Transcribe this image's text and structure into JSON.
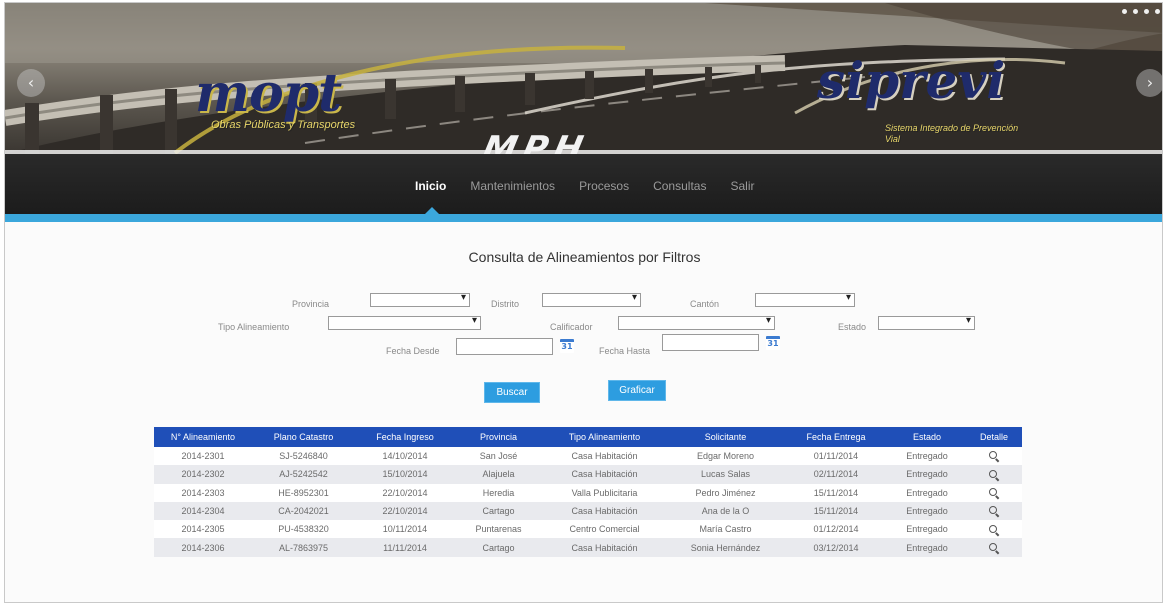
{
  "banner": {
    "logo_left": "mopt",
    "logo_left_sub": "Obras Públicas y Transportes",
    "logo_center": "MPH",
    "logo_right": "siprevi",
    "logo_right_sub": "Sistema Integrado de Prevención Vial",
    "prev_arrow": "‹",
    "next_arrow": "›"
  },
  "nav": {
    "items": [
      "Inicio",
      "Mantenimientos",
      "Procesos",
      "Consultas",
      "Salir"
    ],
    "active": "Inicio"
  },
  "page": {
    "title": "Consulta de Alineamientos por Filtros"
  },
  "filters": {
    "provincia_label": "Provincia",
    "distrito_label": "Distrito",
    "canton_label": "Cantón",
    "tipo_label": "Tipo Alineamiento",
    "calificador_label": "Calificador",
    "estado_label": "Estado",
    "fecha_desde_label": "Fecha Desde",
    "fecha_hasta_label": "Fecha Hasta",
    "calendar_glyph": "31"
  },
  "buttons": {
    "buscar": "Buscar",
    "graficar": "Graficar"
  },
  "table": {
    "headers": [
      "N° Alineamiento",
      "Plano Catastro",
      "Fecha Ingreso",
      "Provincia",
      "Tipo Alineamiento",
      "Solicitante",
      "Fecha Entrega",
      "Estado",
      "Detalle"
    ],
    "rows": [
      [
        "2014-2301",
        "SJ-5246840",
        "14/10/2014",
        "San José",
        "Casa Habitación",
        "Edgar Moreno",
        "01/11/2014",
        "Entregado"
      ],
      [
        "2014-2302",
        "AJ-5242542",
        "15/10/2014",
        "Alajuela",
        "Casa Habitación",
        "Lucas Salas",
        "02/11/2014",
        "Entregado"
      ],
      [
        "2014-2303",
        "HE-8952301",
        "22/10/2014",
        "Heredia",
        "Valla Publicitaria",
        "Pedro Jiménez",
        "15/11/2014",
        "Entregado"
      ],
      [
        "2014-2304",
        "CA-2042021",
        "22/10/2014",
        "Cartago",
        "Casa Habitación",
        "Ana de la O",
        "15/11/2014",
        "Entregado"
      ],
      [
        "2014-2305",
        "PU-4538320",
        "10/11/2014",
        "Puntarenas",
        "Centro Comercial",
        "María Castro",
        "01/12/2014",
        "Entregado"
      ],
      [
        "2014-2306",
        "AL-7863975",
        "11/11/2014",
        "Cartago",
        "Casa Habitación",
        "Sonia Hernández",
        "03/12/2014",
        "Entregado"
      ]
    ]
  }
}
